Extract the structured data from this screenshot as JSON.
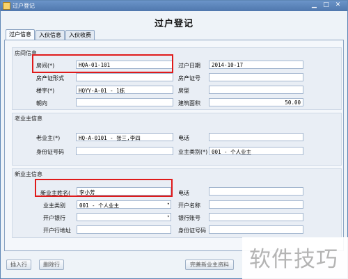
{
  "window": {
    "title": "过户登记"
  },
  "page": {
    "heading": "过户登记"
  },
  "tabs": [
    {
      "label": "过户信息",
      "active": true
    },
    {
      "label": "入伙信息",
      "active": false
    },
    {
      "label": "入伙收费",
      "active": false
    }
  ],
  "room_group": {
    "title": "房间信息",
    "room_label": "房间(*)",
    "room_value": "HQA-01-101",
    "transfer_date_label": "过户日期",
    "transfer_date_value": "2014-10-17",
    "property_cert_form_label": "房产证形式",
    "property_cert_form_value": "",
    "property_cert_no_label": "房产证号",
    "property_cert_no_value": "",
    "building_label": "楼宇(*)",
    "building_value": "HQYY-A-01 - 1栋",
    "room_type_label": "房型",
    "room_type_value": "",
    "orientation_label": "朝向",
    "orientation_value": "",
    "area_label": "建筑面积",
    "area_value": "50.00"
  },
  "old_owner_group": {
    "title": "老业主信息",
    "owner_label": "老业主(*)",
    "owner_value": "HQ-A-0101 - 张三,李四",
    "phone_label": "电话",
    "phone_value": "",
    "id_no_label": "身份证号码",
    "id_no_value": "",
    "owner_type_label": "业主类别(*)",
    "owner_type_value": "001 - 个人业主"
  },
  "new_owner_group": {
    "title": "新业主信息",
    "name_label": "新业主姓名(",
    "name_value": "李小芳",
    "phone_label": "电话",
    "phone_value": "",
    "owner_type_label": "业主类别",
    "owner_type_value": "001 - 个人业主",
    "account_name_label": "开户名称",
    "account_name_value": "",
    "bank_label": "开户银行",
    "bank_value": "",
    "bank_account_label": "银行账号",
    "bank_account_value": "",
    "bank_address_label": "开户行地址",
    "bank_address_value": "",
    "id_no_label": "身份证号码",
    "id_no_value": ""
  },
  "buttons": {
    "insert_row": "插入行",
    "delete_row": "删除行",
    "complete_new_owner": "完善新业主资料"
  },
  "watermark": {
    "text": "软件技巧"
  },
  "colors": {
    "highlight": "#e01a1a",
    "title_bar": "#5a82b8"
  }
}
